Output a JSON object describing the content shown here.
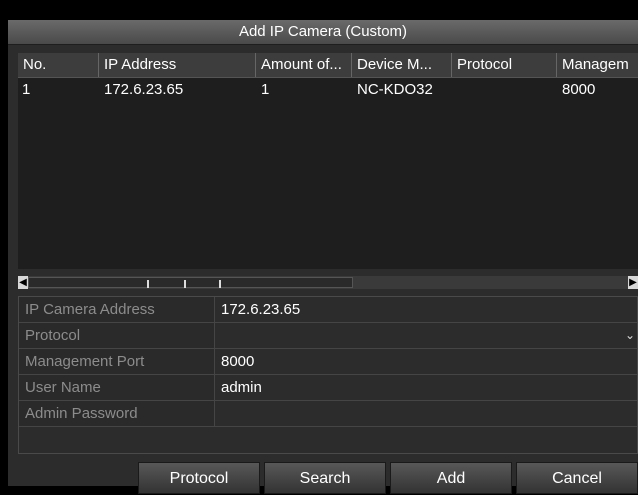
{
  "window": {
    "title": "Add IP Camera (Custom)"
  },
  "table": {
    "columns": [
      "No.",
      "IP Address",
      "Amount of...",
      "Device M...",
      "Protocol",
      "Managem"
    ],
    "rows": [
      [
        "1",
        "172.6.23.65",
        "1",
        "NC-KDO32",
        "",
        "8000"
      ]
    ]
  },
  "scrollbar": {
    "left_icon": "chevron-left-icon",
    "right_icon": "chevron-right-icon"
  },
  "form": {
    "ip_address": {
      "label": "IP Camera Address",
      "value": "172.6.23.65"
    },
    "protocol": {
      "label": "Protocol",
      "value": ""
    },
    "management_port": {
      "label": "Management Port",
      "value": "8000"
    },
    "user_name": {
      "label": "User Name",
      "value": "admin"
    },
    "admin_password": {
      "label": "Admin Password",
      "value": ""
    }
  },
  "buttons": {
    "protocol": "Protocol",
    "search": "Search",
    "add": "Add",
    "cancel": "Cancel"
  },
  "colors": {
    "title_bar": "#5a5a5a",
    "window_bg": "#2c2c2c",
    "list_bg": "#1e1e1e",
    "label_text": "#8c8c8c",
    "scroll_arrow": "#d8d8d8"
  }
}
